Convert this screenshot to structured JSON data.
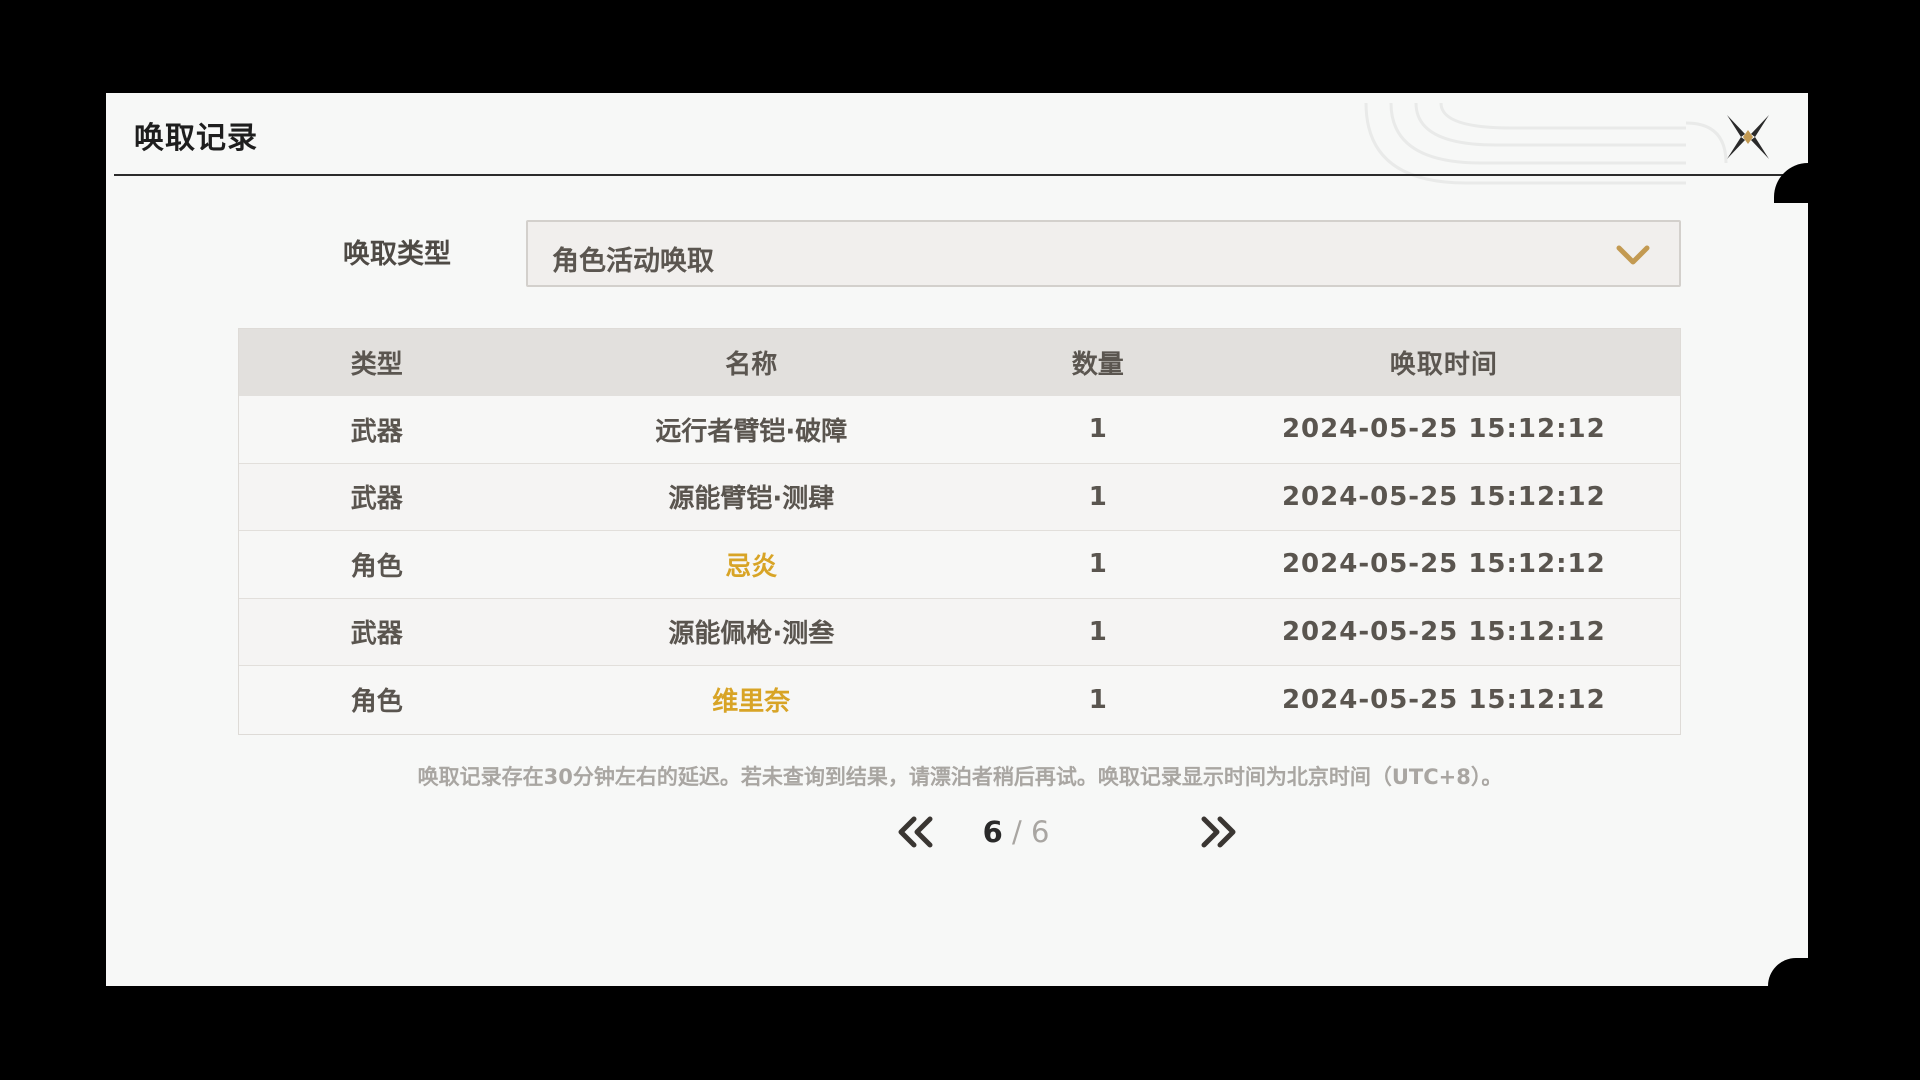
{
  "dialog": {
    "title": "唤取记录"
  },
  "filter": {
    "label": "唤取类型",
    "selected": "角色活动唤取"
  },
  "table": {
    "headers": [
      "类型",
      "名称",
      "数量",
      "唤取时间"
    ],
    "rows": [
      {
        "type": "武器",
        "name": "远行者臂铠·破障",
        "qty": "1",
        "time": "2024-05-25 15:12:12",
        "highlight": false
      },
      {
        "type": "武器",
        "name": "源能臂铠·测肆",
        "qty": "1",
        "time": "2024-05-25 15:12:12",
        "highlight": false
      },
      {
        "type": "角色",
        "name": "忌炎",
        "qty": "1",
        "time": "2024-05-25 15:12:12",
        "highlight": true
      },
      {
        "type": "武器",
        "name": "源能佩枪·测叁",
        "qty": "1",
        "time": "2024-05-25 15:12:12",
        "highlight": false
      },
      {
        "type": "角色",
        "name": "维里奈",
        "qty": "1",
        "time": "2024-05-25 15:12:12",
        "highlight": true
      }
    ]
  },
  "note": "唤取记录存在30分钟左右的延迟。若未查询到结果，请漂泊者稍后再试。唤取记录显示时间为北京时间（UTC+8）。",
  "pagination": {
    "current": "6",
    "separator": "/",
    "total": "6"
  },
  "icons": {
    "close": "close-x-icon",
    "dropdown": "chevron-down-icon",
    "prev": "double-chevron-left-icon",
    "next": "double-chevron-right-icon"
  },
  "colors": {
    "background": "#000000",
    "panel": "#f7f8f7",
    "header_row": "#e2e0dd",
    "text": "#5a554f",
    "highlight": "#d8a426",
    "chevron_gold": "#c39a52"
  }
}
